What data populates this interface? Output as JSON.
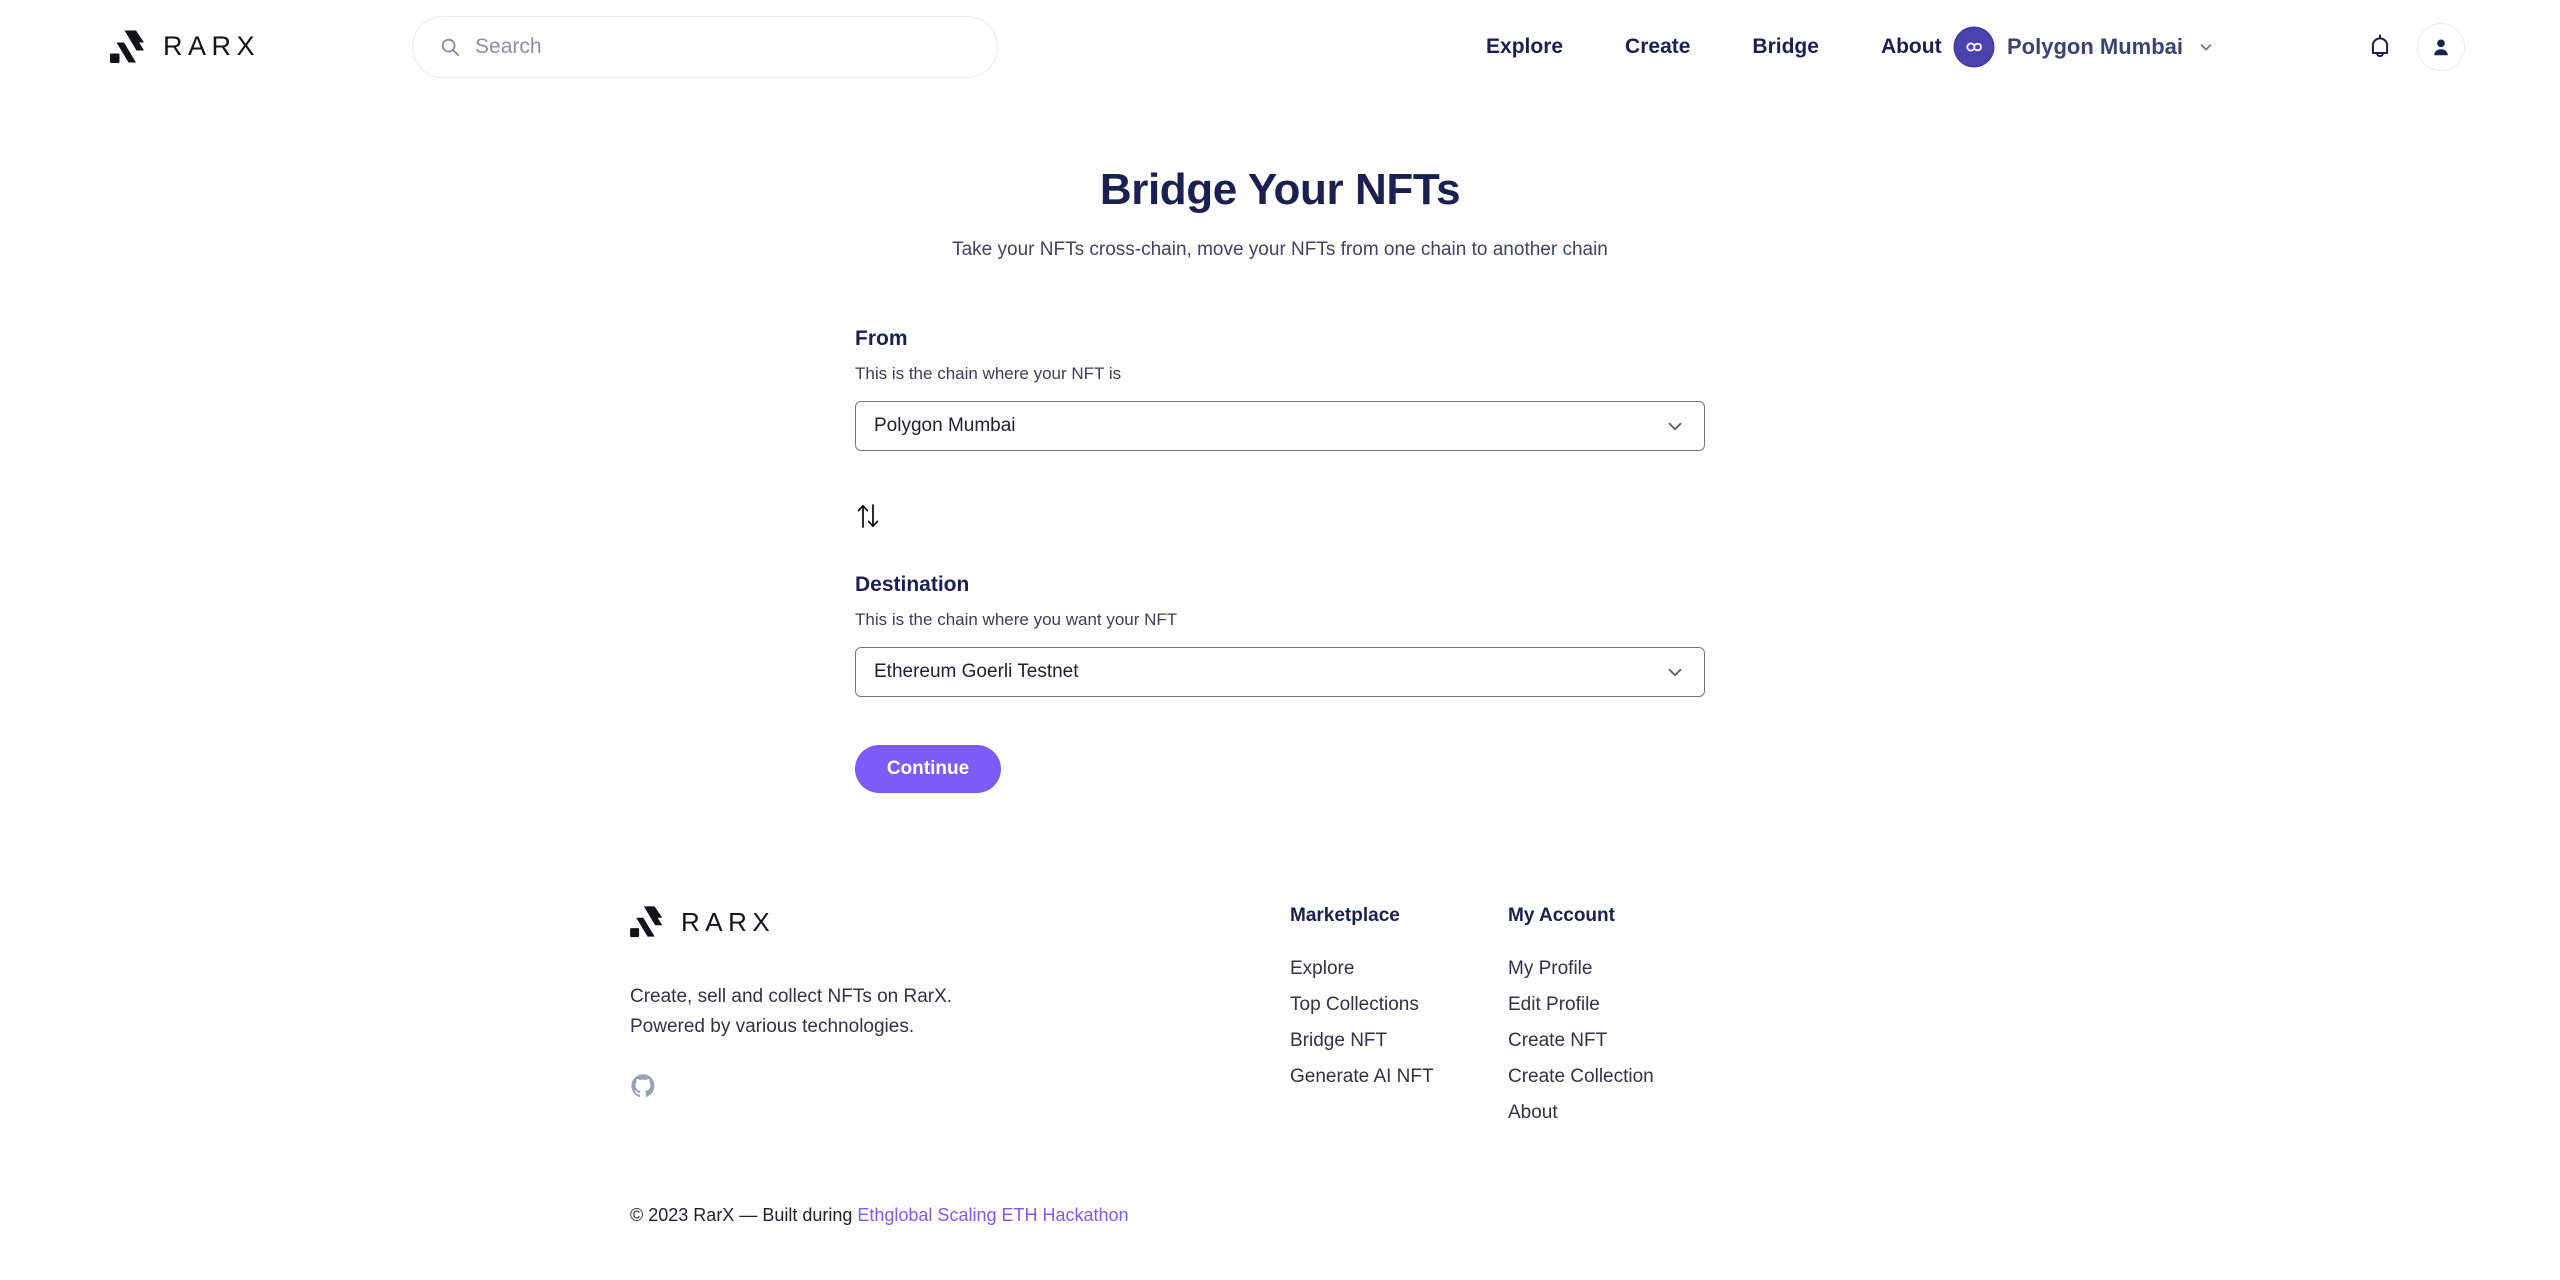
{
  "header": {
    "brand_text": "RARX",
    "search": {
      "placeholder": "Search",
      "value": ""
    },
    "nav": [
      {
        "label": "Explore"
      },
      {
        "label": "Create"
      },
      {
        "label": "Bridge"
      },
      {
        "label": "About"
      }
    ],
    "wallet": {
      "chain_label": "Polygon Mumbai",
      "chain_icon": "polygon-icon",
      "chevron_icon": "chevron-down-icon"
    },
    "notifications_icon": "bell-icon",
    "account_icon": "user-avatar-icon"
  },
  "main": {
    "title": "Bridge Your NFTs",
    "subtitle": "Take your NFTs cross-chain, move your NFTs from one chain to another chain",
    "from": {
      "label": "From",
      "hint": "This is the chain where your NFT is",
      "selected": "Polygon Mumbai",
      "options": [
        "Polygon Mumbai",
        "Ethereum Goerli Testnet"
      ]
    },
    "swap_icon": "swap-vertical-icon",
    "destination": {
      "label": "Destination",
      "hint": "This is the chain where you want your NFT",
      "selected": "Ethereum Goerli Testnet",
      "options": [
        "Ethereum Goerli Testnet",
        "Polygon Mumbai"
      ]
    },
    "continue_label": "Continue"
  },
  "footer": {
    "brand_text": "RARX",
    "description": "Create, sell and collect NFTs on RarX. Powered by various technologies.",
    "github_icon": "github-icon",
    "columns": [
      {
        "title": "Marketplace",
        "links": [
          {
            "label": "Explore"
          },
          {
            "label": "Top Collections"
          },
          {
            "label": "Bridge NFT"
          },
          {
            "label": "Generate AI NFT"
          }
        ]
      },
      {
        "title": "My Account",
        "links": [
          {
            "label": "My Profile"
          },
          {
            "label": "Edit Profile"
          },
          {
            "label": "Create NFT"
          },
          {
            "label": "Create Collection"
          },
          {
            "label": "About"
          }
        ]
      }
    ],
    "copyright_prefix": "© 2023 RarX — Built during ",
    "copyright_link": "Ethglobal Scaling ETH Hackathon"
  },
  "colors": {
    "accent_purple": "#7c5cf7",
    "navy": "#1b2050",
    "chain_badge": "#4c42ad"
  }
}
